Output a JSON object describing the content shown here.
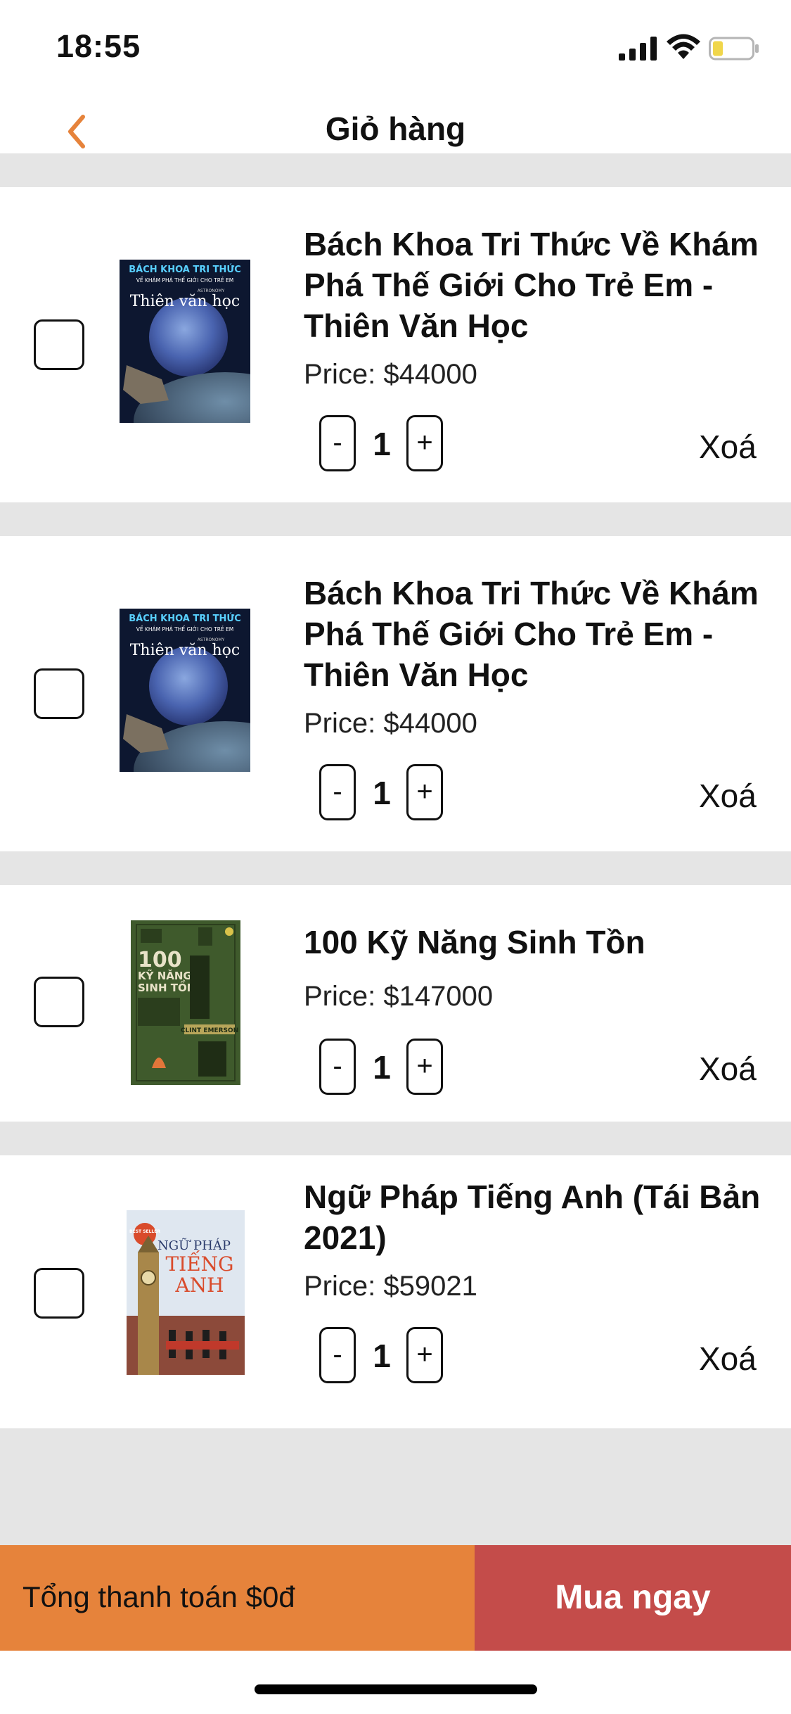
{
  "status_bar": {
    "time": "18:55"
  },
  "nav": {
    "title": "Giỏ hàng",
    "back_icon": "chevron-left-icon",
    "accent_color": "#e6833b"
  },
  "cart_items": [
    {
      "title": "Bách Khoa Tri Thức Về Khám Phá Thế Giới Cho Trẻ Em - Thiên Văn Học",
      "price": "Price: $44000",
      "quantity": "1",
      "minus_label": "-",
      "plus_label": "+",
      "remove_label": "Xoá",
      "cover": {
        "top_title": "BÁCH KHOA TRI THỨC",
        "subtitle": "VỀ KHÁM PHÁ THẾ GIỚI CHO TRẺ EM",
        "small": "ASTRONOMY",
        "main": "Thiên văn học"
      }
    },
    {
      "title": "Bách Khoa Tri Thức Về Khám Phá Thế Giới Cho Trẻ Em - Thiên Văn Học",
      "price": "Price: $44000",
      "quantity": "1",
      "minus_label": "-",
      "plus_label": "+",
      "remove_label": "Xoá",
      "cover": {
        "top_title": "BÁCH KHOA TRI THỨC",
        "subtitle": "VỀ KHÁM PHÁ THẾ GIỚI CHO TRẺ EM",
        "small": "ASTRONOMY",
        "main": "Thiên văn học"
      }
    },
    {
      "title": "100 Kỹ Năng Sinh Tồn",
      "price": "Price: $147000",
      "quantity": "1",
      "minus_label": "-",
      "plus_label": "+",
      "remove_label": "Xoá",
      "cover": {
        "number": "100",
        "line1": "KỸ NĂNG",
        "line2": "SINH TỒN",
        "author": "CLINT EMERSON"
      }
    },
    {
      "title": "Ngữ Pháp Tiếng Anh (Tái Bản 2021)",
      "price": "Price: $59021",
      "quantity": "1",
      "minus_label": "-",
      "plus_label": "+",
      "remove_label": "Xoá",
      "cover": {
        "badge": "BEST SELLER",
        "line1": "NGỮ PHÁP",
        "line2": "TIẾNG",
        "line3": "ANH"
      }
    }
  ],
  "footer": {
    "total_text": "Tổng thanh toán $0đ",
    "buy_label": "Mua ngay",
    "total_bg": "#e6833b",
    "buy_bg": "#c44c4a"
  }
}
